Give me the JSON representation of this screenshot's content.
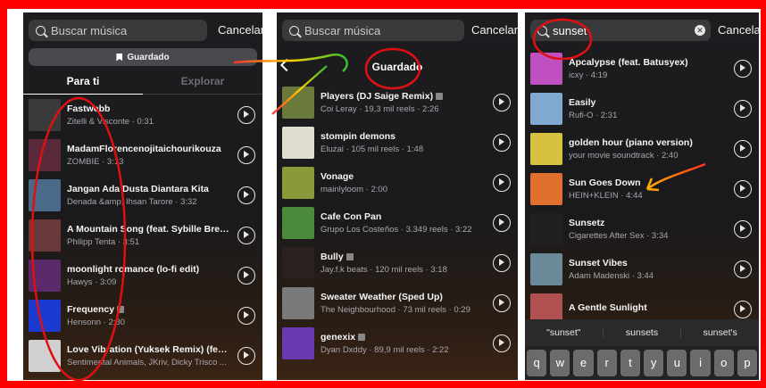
{
  "panel1": {
    "search_placeholder": "Buscar música",
    "cancel": "Cancelar",
    "saved_button": "Guardado",
    "tabs": [
      {
        "label": "Para ti"
      },
      {
        "label": "Explorar"
      }
    ],
    "tracks": [
      {
        "title": "Fastwebb",
        "sub": "Zitelli & Visconte · 0:31",
        "color": "#3a3a3a",
        "badge": false
      },
      {
        "title": "MadamFlorencenojitaichourikouza",
        "sub": "ZOMBIE · 3:13",
        "color": "#5a2a3a",
        "badge": false
      },
      {
        "title": "Jangan Ada Dusta Diantara Kita",
        "sub": "Denada &amp; Ihsan Tarore · 3:32",
        "color": "#4a6a8a",
        "badge": false
      },
      {
        "title": "A Mountain Song (feat. Sybille Breuer, D...",
        "sub": "Philipp Tenta · 3:51",
        "color": "#6a3a3a",
        "badge": false
      },
      {
        "title": "moonlight romance (lo-fi edit)",
        "sub": "Hawys · 3:09",
        "color": "#5a2a6a",
        "badge": false
      },
      {
        "title": "Frequency",
        "sub": "Hensonn · 2:30",
        "color": "#1a3ad0",
        "badge": true
      },
      {
        "title": "Love Vibration (Yuksek Remix) (feat. Nic...",
        "sub": "Sentimental Animals, JKriv, Dicky Trisco ...",
        "color": "#d0d0d0",
        "badge": false
      }
    ]
  },
  "panel2": {
    "search_placeholder": "Buscar música",
    "cancel": "Cancelar",
    "title": "Guardado",
    "tracks": [
      {
        "title": "Players (DJ Saige Remix)",
        "sub": "Coi Leray · 19,3 mil reels · 2:26",
        "color": "#6a7a3a",
        "badge": true
      },
      {
        "title": "stompin demons",
        "sub": "Eluzai · 105 mil reels · 1:48",
        "color": "#e0ddd0",
        "badge": false
      },
      {
        "title": "Vonage",
        "sub": "mainlyloom · 2:00",
        "color": "#8a9a3a",
        "badge": false
      },
      {
        "title": "Cafe Con Pan",
        "sub": "Grupo Los Costeños · 3.349 reels · 3:22",
        "color": "#4a8a3a",
        "badge": false
      },
      {
        "title": "Bully",
        "sub": "Jay.f.k beats · 120 mil reels · 3:18",
        "color": "#2a2020",
        "badge": true
      },
      {
        "title": "Sweater Weather (Sped Up)",
        "sub": "The Neighbourhood · 73 mil reels · 0:29",
        "color": "#7a7a7a",
        "badge": false
      },
      {
        "title": "genexix",
        "sub": "Dyan Dxddy · 89,9 mil reels · 2:22",
        "color": "#6a3ab0",
        "badge": true
      }
    ]
  },
  "panel3": {
    "search_value": "sunset",
    "cancel": "Cancelar",
    "tracks": [
      {
        "title": "Apcalypse (feat. Batusyex)",
        "sub": "icxy · 4:19",
        "color": "#c050c0",
        "badge": false
      },
      {
        "title": "Easily",
        "sub": "Rufi-O · 2:31",
        "color": "#80a8d0",
        "badge": false
      },
      {
        "title": "golden hour (piano version)",
        "sub": "your movie soundtrack · 2:40",
        "color": "#d8c040",
        "badge": false
      },
      {
        "title": "Sun Goes Down",
        "sub": "HEIN+KLEIN · 4:44",
        "color": "#e07030",
        "badge": false
      },
      {
        "title": "Sunsetz",
        "sub": "Cigarettes After Sex · 3:34",
        "color": "#202020",
        "badge": false
      },
      {
        "title": "Sunset Vibes",
        "sub": "Adam Madenski · 3:44",
        "color": "#6a8a9a",
        "badge": false
      },
      {
        "title": "A Gentle Sunlight",
        "sub": "",
        "color": "#b05050",
        "badge": false
      }
    ],
    "suggestions": [
      "\"sunset\"",
      "sunsets",
      "sunset's"
    ],
    "keys": [
      "q",
      "w",
      "e",
      "r",
      "t",
      "y",
      "u",
      "i",
      "o",
      "p"
    ]
  },
  "colors": {
    "annotation": "#e01010",
    "arrow_gradient": [
      "#ff3030",
      "#ffd000",
      "#30c030"
    ]
  }
}
